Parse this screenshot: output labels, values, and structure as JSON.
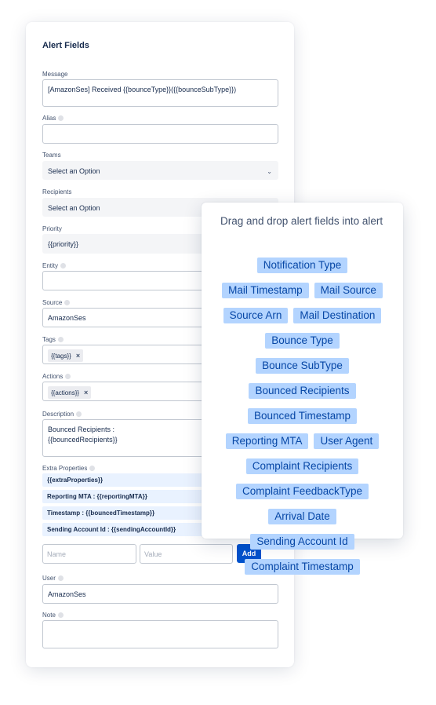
{
  "form": {
    "title": "Alert Fields",
    "message": {
      "label": "Message",
      "value": "[AmazonSes] Received {{bounceType}}({{bounceSubType}})"
    },
    "alias": {
      "label": "Alias",
      "value": ""
    },
    "teams": {
      "label": "Teams",
      "value": "Select an Option"
    },
    "recipients": {
      "label": "Recipients",
      "value": "Select an Option"
    },
    "priority": {
      "label": "Priority",
      "value": "{{priority}}"
    },
    "entity": {
      "label": "Entity",
      "value": ""
    },
    "source": {
      "label": "Source",
      "value": "AmazonSes"
    },
    "tags": {
      "label": "Tags",
      "chip": "{{tags}}"
    },
    "actions": {
      "label": "Actions",
      "chip": "{{actions}}"
    },
    "description": {
      "label": "Description",
      "value": "Bounced Recipients :\n{{bouncedRecipients}}"
    },
    "extra_properties": {
      "label": "Extra Properties",
      "rows": [
        "{{extraProperties}}",
        "Reporting MTA : {{reportingMTA}}",
        "Timestamp : {{bouncedTimestamp}}",
        "Sending Account Id : {{sendingAccountId}}"
      ],
      "name_placeholder": "Name",
      "value_placeholder": "Value",
      "add_label": "Add"
    },
    "user": {
      "label": "User",
      "value": "AmazonSes"
    },
    "note": {
      "label": "Note",
      "value": ""
    }
  },
  "panel": {
    "title": "Drag and drop alert fields into alert",
    "fields": [
      "Notification Type",
      "Mail Timestamp",
      "Mail Source",
      "Source Arn",
      "Mail Destination",
      "Bounce Type",
      "Bounce SubType",
      "Bounced Recipients",
      "Bounced Timestamp",
      "Reporting MTA",
      "User Agent",
      "Complaint Recipients",
      "Complaint FeedbackType",
      "Arrival Date",
      "Sending Account Id",
      "Complaint Timestamp"
    ]
  },
  "colors": {
    "accent": "#0052cc",
    "chip_bg": "#b3d4ff",
    "chip_text": "#0747a6",
    "extra_bg": "#e9f2ff"
  }
}
